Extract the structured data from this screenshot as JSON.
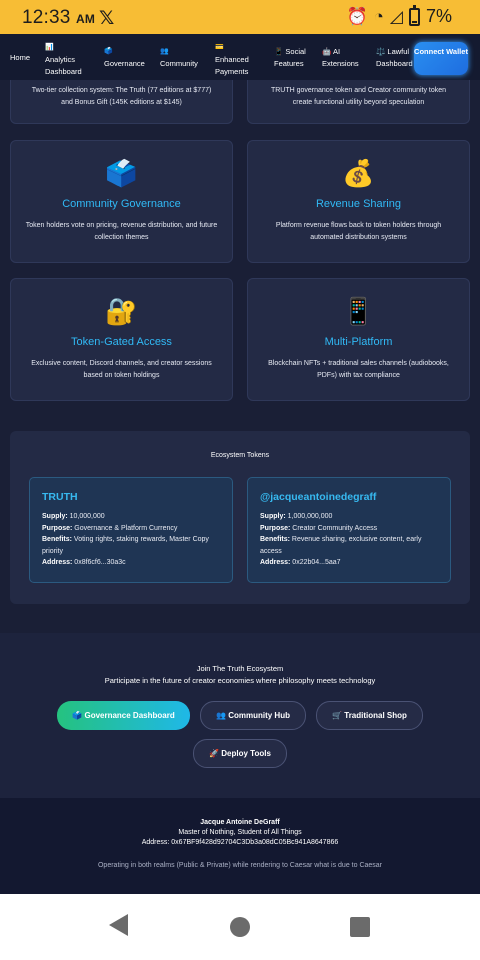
{
  "status": {
    "time": "12:33",
    "ampm": "AM",
    "battery": "7%"
  },
  "nav": [
    {
      "id": "home",
      "label": "Home",
      "emoji": ""
    },
    {
      "id": "analytics",
      "label": "Analytics Dashboard",
      "emoji": "📊"
    },
    {
      "id": "governance",
      "label": "Governance",
      "emoji": "🗳️"
    },
    {
      "id": "community",
      "label": "Community",
      "emoji": "👥"
    },
    {
      "id": "payments",
      "label": "Enhanced Payments",
      "emoji": "💳"
    },
    {
      "id": "social",
      "label": "📱 Social Features",
      "emoji": ""
    },
    {
      "id": "ai",
      "label": "🤖 AI Extensions",
      "emoji": ""
    },
    {
      "id": "lawful",
      "label": "⚖️ Lawful Dashboard",
      "emoji": ""
    }
  ],
  "connect_wallet": "Connect Wallet",
  "top_cards": [
    {
      "desc": "Two-tier collection system: The Truth (77 editions at $777) and Bonus Gift (145K editions at $145)"
    },
    {
      "desc": "TRUTH governance token and Creator community token create functional utility beyond speculation"
    }
  ],
  "features": [
    {
      "icon": "🗳️",
      "title": "Community Governance",
      "desc": "Token holders vote on pricing, revenue distribution, and future collection themes"
    },
    {
      "icon": "💰",
      "title": "Revenue Sharing",
      "desc": "Platform revenue flows back to token holders through automated distribution systems"
    },
    {
      "icon": "🔐",
      "title": "Token-Gated Access",
      "desc": "Exclusive content, Discord channels, and creator sessions based on token holdings"
    },
    {
      "icon": "📱",
      "title": "Multi-Platform",
      "desc": "Blockchain NFTs + traditional sales channels (audiobooks, PDFs) with tax compliance"
    }
  ],
  "ecosystem": {
    "heading": "Ecosystem Tokens",
    "tokens": [
      {
        "name": "TRUTH",
        "supply": "10,000,000",
        "purpose": "Governance & Platform Currency",
        "benefits": "Voting rights, staking rewards, Master Copy priority",
        "address": "0x8f6cf6...30a3c"
      },
      {
        "name": "@jacqueantoinedegraff",
        "supply": "1,000,000,000",
        "purpose": "Creator Community Access",
        "benefits": "Revenue sharing, exclusive content, early access",
        "address": "0x22b04...5aa7"
      }
    ],
    "labels": {
      "supply": "Supply:",
      "purpose": "Purpose:",
      "benefits": "Benefits:",
      "address": "Address:"
    }
  },
  "join": {
    "title": "Join The Truth Ecosystem",
    "subtitle": "Participate in the future of creator economies where philosophy meets technology",
    "buttons": {
      "governance": "🗳️ Governance Dashboard",
      "community": "👥 Community Hub",
      "shop": "🛒 Traditional Shop",
      "deploy": "🚀 Deploy Tools"
    }
  },
  "footer": {
    "name": "Jacque Antoine DeGraff",
    "tagline": "Master of Nothing, Student of All Things",
    "address": "Address: 0x67BF9f428d92704C3Db3a08dC05Bc941A8647866",
    "motto": "Operating in both realms (Public & Private) while rendering to Caesar what is due to Caesar"
  }
}
